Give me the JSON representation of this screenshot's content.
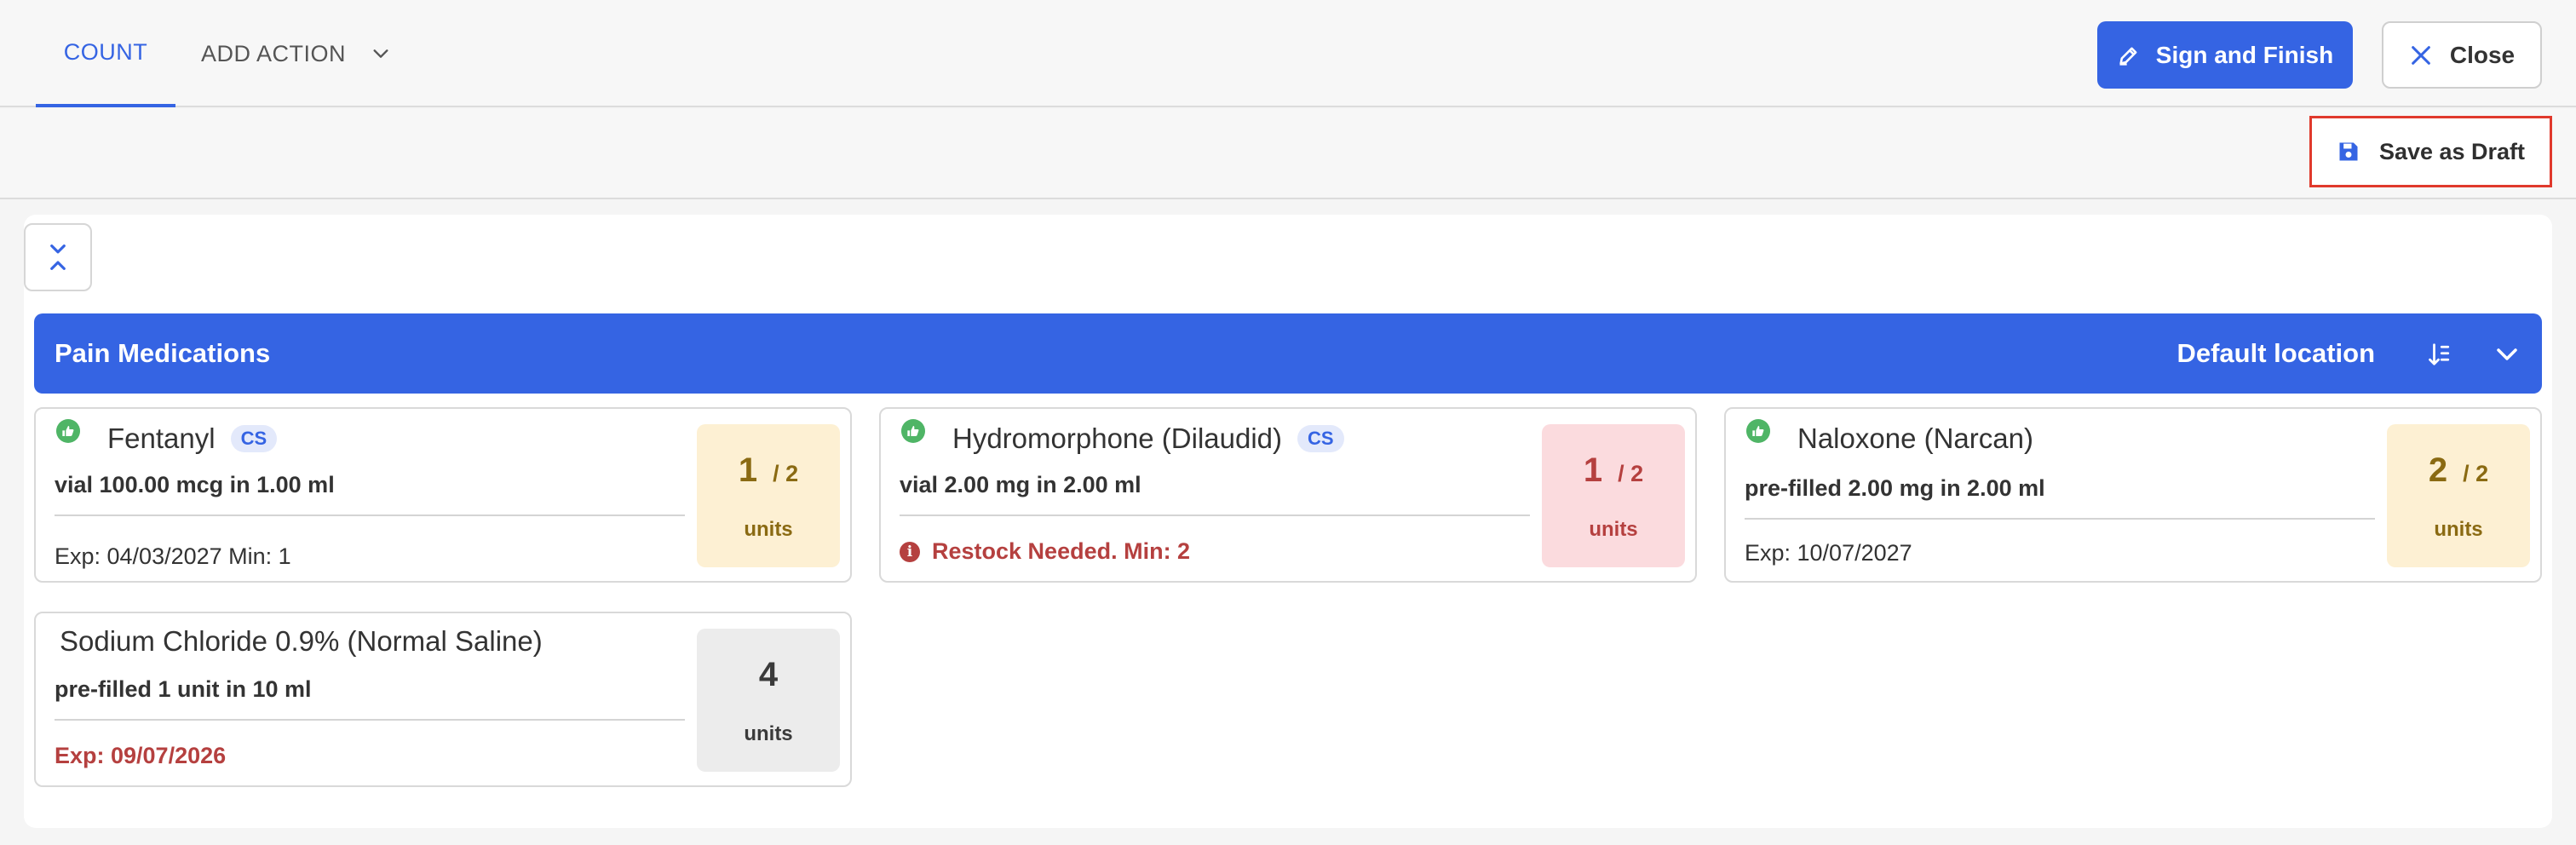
{
  "tabs": {
    "count": "COUNT",
    "add_action": "ADD ACTION"
  },
  "buttons": {
    "sign_finish": "Sign and Finish",
    "close": "Close",
    "save_draft": "Save as Draft"
  },
  "group": {
    "title": "Pain Medications",
    "location": "Default location"
  },
  "cards": [
    {
      "name": "Fentanyl",
      "badge": "CS",
      "desc": "vial 100.00 mcg in 1.00 ml",
      "footer": "Exp: 04/03/2027 Min: 1",
      "count": "1",
      "total": "/ 2",
      "unit": "units"
    },
    {
      "name": "Hydromorphone (Dilaudid)",
      "badge": "CS",
      "desc": "vial 2.00 mg in 2.00 ml",
      "footer": "Restock Needed.  Min: 2",
      "count": "1",
      "total": "/ 2",
      "unit": "units"
    },
    {
      "name": "Naloxone (Narcan)",
      "desc": "pre-filled 2.00 mg in 2.00 ml",
      "footer": "Exp: 10/07/2027",
      "count": "2",
      "total": "/ 2",
      "unit": "units"
    },
    {
      "name": "Sodium Chloride 0.9% (Normal Saline)",
      "desc": "pre-filled 1 unit in 10 ml",
      "footer": "Exp: 09/07/2026",
      "count": "4",
      "unit": "units"
    }
  ],
  "colors": {
    "accent": "#3564e3",
    "danger": "#b5403f",
    "ok": "#4fb566",
    "warn_bg": "#fdf0d3",
    "danger_bg": "#fbdbde"
  },
  "icons": [
    "chevron-down-icon",
    "pencil-icon",
    "close-icon",
    "save-icon",
    "collapse-all-icon",
    "sort-icon",
    "thumbs-up-icon",
    "info-icon"
  ]
}
